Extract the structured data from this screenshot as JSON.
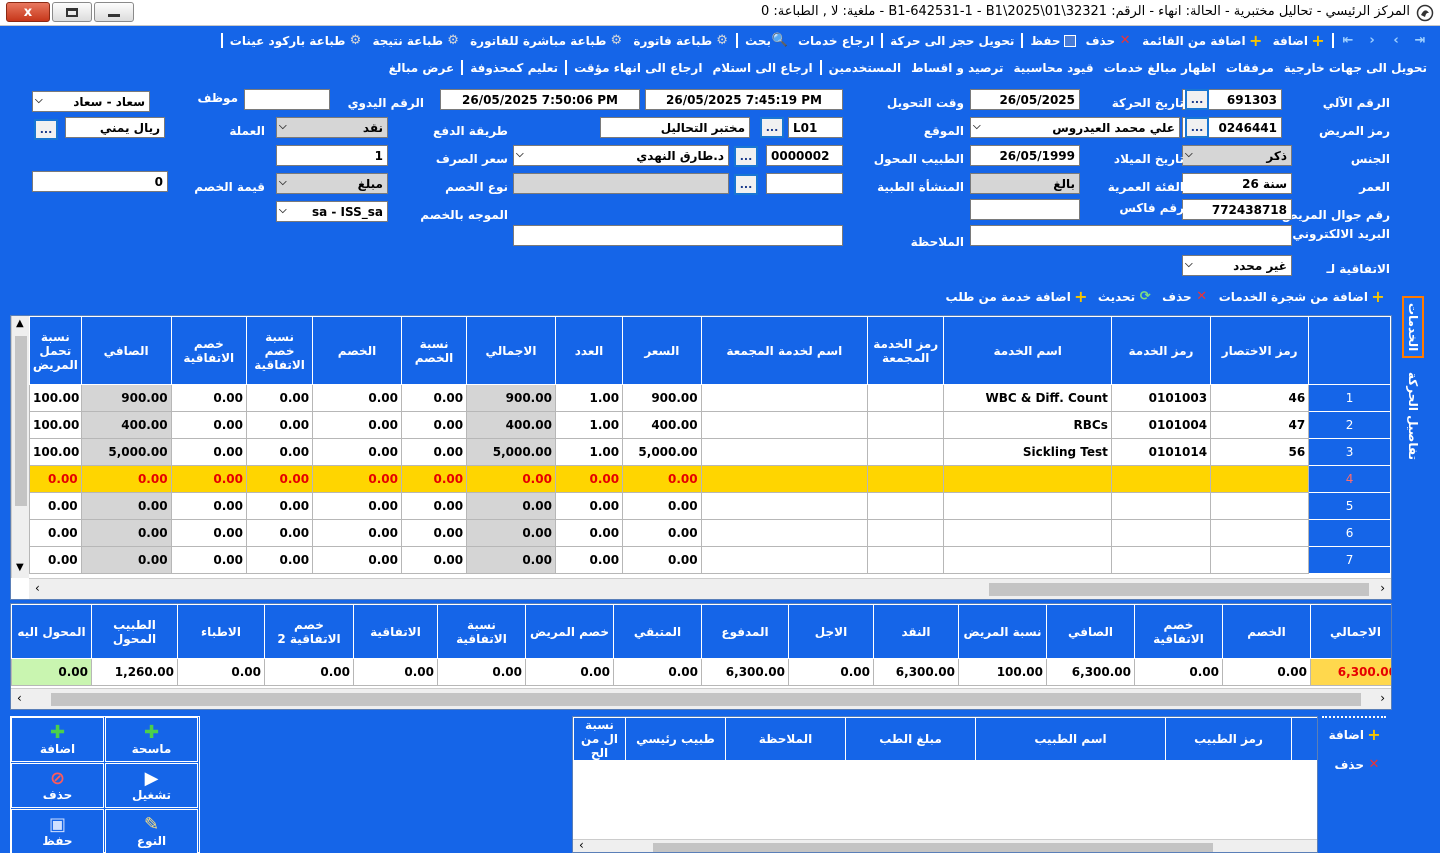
{
  "window": {
    "title": "المركز الرئيسي - تحاليل مختبرية - الحالة: انهاء - الرقم: B1-642531-1 - B1\\2025\\01\\32321 - ملغية: لا , الطباعة: 0",
    "close_label": "x"
  },
  "toolbar1": {
    "items": [
      "اضافة",
      "اضافة من القائمة",
      "حذف",
      "حفظ",
      "تحويل حجز الى حركة",
      "ارجاع خدمات",
      "بحث",
      "طباعة فاتورة",
      "طباعة مباشرة للفاتورة",
      "طباعة نتيجة",
      "طباعة باركود عينات"
    ]
  },
  "toolbar2": {
    "items": [
      "تحويل الى جهات خارجية",
      "مرفقات",
      "اظهار مبالغ خدمات",
      "قيود محاسبية",
      "ترصيد و اقساط",
      "المستخدمين",
      "ارجاع الى استلام",
      "ارجاع الى انهاء مؤقت",
      "تعليم كمحذوفة",
      "عرض مبالغ"
    ]
  },
  "form": {
    "labels": {
      "auto_no": "الرقم الآلي",
      "move_date": "تاريخ الحركة",
      "transfer_time": "وقت التحويل",
      "manual_no": "الرقم اليدوي",
      "employee": "موظف",
      "patient_code": "رمز المريض",
      "location": "الموقع",
      "payment_method": "طريقة الدفع",
      "currency": "العملة",
      "gender": "الجنس",
      "birth_date": "تاريخ الميلاد",
      "ref_doctor": "الطبيب المحول",
      "exchange_rate": "سعر الصرف",
      "age": "العمر",
      "age_group": "الفئة العمرية",
      "medical_facility": "المنشأة الطبية",
      "discount_type": "نوع الخصم",
      "discount_value": "قيمة الخصم",
      "patient_mobile": "رقم جوال المريض",
      "fax_no": "رقم فاكس",
      "discount_directed": "الموجه بالخصم",
      "email": "البريد الالكتروني",
      "note": "الملاحظة",
      "agreement": "الاتفاقية لـ"
    },
    "values": {
      "auto_no": "691303",
      "move_date": "26/05/2025",
      "transfer_time": "26/05/2025 7:45:19 PM",
      "manual_time": "26/05/2025 7:50:06 PM",
      "employee": "سعاد - سعاد",
      "patient_code": "0246441",
      "patient_name": "علي محمد العيدروس",
      "location_code": "L01",
      "location_name": "مختبر التحاليل",
      "payment_method": "نقد",
      "currency": "ريال يمني",
      "gender": "ذكر",
      "birth_date": "26/05/1999",
      "ref_doctor_code": "0000002",
      "ref_doctor_name": "د.طارق النهدي",
      "exchange_rate": "1",
      "age": "26 سنة",
      "age_group": "بالغ",
      "discount_type": "مبلغ",
      "discount_value": "0",
      "patient_mobile": "772438718",
      "discount_directed": "sa - ISS_sa",
      "agreement": "غير محدد",
      "dots": "..."
    }
  },
  "services_bar": {
    "items": [
      "اضافة من شجرة الخدمات",
      "حذف",
      "تحديث",
      "اضافة خدمة من طلب"
    ]
  },
  "side_tabs": {
    "services": "الخدمات",
    "move_details": "تفاصيل الحركة"
  },
  "services_grid": {
    "columns": [
      "رمز الاختصار",
      "رمز الخدمة",
      "اسم الخدمة",
      "رمز الخدمة المجمعة",
      "اسم لخدمة المجمعة",
      "السعر",
      "العدد",
      "الاجمالي",
      "نسبة الخصم",
      "الخصم",
      "نسبة خصم الاتفاقية",
      "خصم الاتفاقية",
      "الصافي",
      "نسبة تحمل المريض"
    ],
    "rows": [
      {
        "n": "1",
        "abbr": "46",
        "code": "0101003",
        "name": "WBC & Diff. Count",
        "gcode": "",
        "gname": "",
        "price": "900.00",
        "qty": "1.00",
        "total": "900.00",
        "disc_pct": "0.00",
        "disc": "0.00",
        "agr_pct": "0.00",
        "agr_disc": "0.00",
        "net": "900.00",
        "pat_pct": "100.00"
      },
      {
        "n": "2",
        "abbr": "47",
        "code": "0101004",
        "name": "RBCs",
        "gcode": "",
        "gname": "",
        "price": "400.00",
        "qty": "1.00",
        "total": "400.00",
        "disc_pct": "0.00",
        "disc": "0.00",
        "agr_pct": "0.00",
        "agr_disc": "0.00",
        "net": "400.00",
        "pat_pct": "100.00"
      },
      {
        "n": "3",
        "abbr": "56",
        "code": "0101014",
        "name": "Sickling Test",
        "gcode": "",
        "gname": "",
        "price": "5,000.00",
        "qty": "1.00",
        "total": "5,000.00",
        "disc_pct": "0.00",
        "disc": "0.00",
        "agr_pct": "0.00",
        "agr_disc": "0.00",
        "net": "5,000.00",
        "pat_pct": "100.00"
      },
      {
        "n": "4",
        "abbr": "",
        "code": "",
        "name": "",
        "gcode": "",
        "gname": "",
        "price": "0.00",
        "qty": "0.00",
        "total": "0.00",
        "disc_pct": "0.00",
        "disc": "0.00",
        "agr_pct": "0.00",
        "agr_disc": "0.00",
        "net": "0.00",
        "pat_pct": "0.00"
      },
      {
        "n": "5",
        "abbr": "",
        "code": "",
        "name": "",
        "gcode": "",
        "gname": "",
        "price": "0.00",
        "qty": "0.00",
        "total": "0.00",
        "disc_pct": "0.00",
        "disc": "0.00",
        "agr_pct": "0.00",
        "agr_disc": "0.00",
        "net": "0.00",
        "pat_pct": "0.00"
      },
      {
        "n": "6",
        "abbr": "",
        "code": "",
        "name": "",
        "gcode": "",
        "gname": "",
        "price": "0.00",
        "qty": "0.00",
        "total": "0.00",
        "disc_pct": "0.00",
        "disc": "0.00",
        "agr_pct": "0.00",
        "agr_disc": "0.00",
        "net": "0.00",
        "pat_pct": "0.00"
      },
      {
        "n": "7",
        "abbr": "",
        "code": "",
        "name": "",
        "gcode": "",
        "gname": "",
        "price": "0.00",
        "qty": "0.00",
        "total": "0.00",
        "disc_pct": "0.00",
        "disc": "0.00",
        "agr_pct": "0.00",
        "agr_disc": "0.00",
        "net": "0.00",
        "pat_pct": "0.00"
      }
    ],
    "selected_row": 3
  },
  "totals_grid": {
    "columns": [
      "الاجمالي",
      "الخصم",
      "خصم الاتفاقية",
      "الصافي",
      "نسبة المريض",
      "النقد",
      "الاجل",
      "المدفوع",
      "المتبقي",
      "خصم المريض",
      "نسبة الاتفاقية",
      "الاتفاقية",
      "خصم الاتفاقية 2",
      "الاطباء",
      "الطبيب المحول",
      "المحول اليه"
    ],
    "values": [
      "6,300.00",
      "0.00",
      "0.00",
      "6,300.00",
      "100.00",
      "6,300.00",
      "0.00",
      "6,300.00",
      "0.00",
      "0.00",
      "0.00",
      "0.00",
      "0.00",
      "0.00",
      "1,260.00",
      "0.00"
    ]
  },
  "doctor_panel": {
    "add": "اضافة",
    "delete": "حذف",
    "columns": [
      "رمز الطبيب",
      "اسم الطبيب",
      "مبلغ الطب",
      "الملاحظة",
      "طبيب رئيسي",
      "نسبة ال من الح"
    ]
  },
  "action_buttons": {
    "add": "اضافة",
    "scan": "ماسحة",
    "delete": "حذف",
    "run": "تشغيل",
    "save": "حفظ",
    "type": "النوع"
  },
  "colors": {
    "brand_blue": "#1565e8",
    "selected_row": "#ffd500",
    "selected_text": "#e60000",
    "total_highlight": "#ffd84d",
    "net_highlight": "#c9f5b0"
  }
}
